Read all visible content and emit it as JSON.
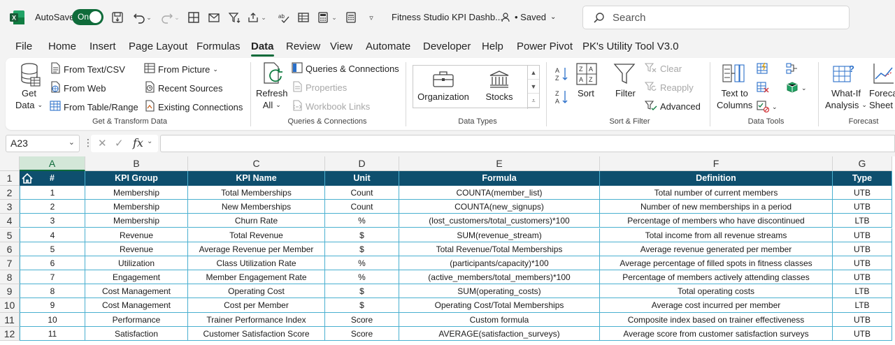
{
  "titlebar": {
    "autosave_label": "AutoSave",
    "toggle_state": "On",
    "doc_title": "Fitness Studio KPI Dashb...",
    "saved_status": "• Saved",
    "search_placeholder": "Search"
  },
  "menu": {
    "tabs": [
      "File",
      "Home",
      "Insert",
      "Page Layout",
      "Formulas",
      "Data",
      "Review",
      "View",
      "Automate",
      "Developer",
      "Help",
      "Power Pivot",
      "PK's Utility Tool V3.0"
    ],
    "active_tab": "Data"
  },
  "ribbon": {
    "get_data": [
      "Get",
      "Data"
    ],
    "from_text_csv": "From Text/CSV",
    "from_web": "From Web",
    "from_table_range": "From Table/Range",
    "from_picture": "From Picture",
    "recent_sources": "Recent Sources",
    "existing_connections": "Existing Connections",
    "group_get_transform": "Get & Transform Data",
    "refresh_all": [
      "Refresh",
      "All"
    ],
    "queries_connections": "Queries & Connections",
    "properties": "Properties",
    "workbook_links": "Workbook Links",
    "group_queries": "Queries & Connections",
    "organization": "Organization",
    "stocks": "Stocks",
    "group_data_types": "Data Types",
    "sort": "Sort",
    "filter": "Filter",
    "clear": "Clear",
    "reapply": "Reapply",
    "advanced": "Advanced",
    "group_sort_filter": "Sort & Filter",
    "text_to_columns": [
      "Text to",
      "Columns"
    ],
    "group_data_tools": "Data Tools",
    "what_if": [
      "What-If",
      "Analysis"
    ],
    "forecast_sheet": [
      "Foreca",
      "Sheet"
    ],
    "group_forecast": "Forecast"
  },
  "formula_bar": {
    "name_box": "A23",
    "fx": "fx",
    "formula": ""
  },
  "grid": {
    "columns": [
      "A",
      "B",
      "C",
      "D",
      "E",
      "F",
      "G"
    ],
    "selected_column": "A",
    "row_numbers": [
      "1",
      "2",
      "3",
      "4",
      "5",
      "6",
      "7",
      "8",
      "9",
      "10",
      "11",
      "12"
    ],
    "header": [
      "#",
      "KPI Group",
      "KPI Name",
      "Unit",
      "Formula",
      "Definition",
      "Type"
    ],
    "rows": [
      [
        "1",
        "Membership",
        "Total Memberships",
        "Count",
        "COUNTA(member_list)",
        "Total number of current members",
        "UTB"
      ],
      [
        "2",
        "Membership",
        "New Memberships",
        "Count",
        "COUNTA(new_signups)",
        "Number of new memberships in a period",
        "UTB"
      ],
      [
        "3",
        "Membership",
        "Churn Rate",
        "%",
        "(lost_customers/total_customers)*100",
        "Percentage of members who have discontinued",
        "LTB"
      ],
      [
        "4",
        "Revenue",
        "Total Revenue",
        "$",
        "SUM(revenue_stream)",
        "Total income from all revenue streams",
        "UTB"
      ],
      [
        "5",
        "Revenue",
        "Average Revenue per Member",
        "$",
        "Total Revenue/Total Memberships",
        "Average revenue generated per member",
        "UTB"
      ],
      [
        "6",
        "Utilization",
        "Class Utilization Rate",
        "%",
        "(participants/capacity)*100",
        "Average percentage of filled spots in fitness classes",
        "UTB"
      ],
      [
        "7",
        "Engagement",
        "Member Engagement Rate",
        "%",
        "(active_members/total_members)*100",
        "Percentage of members actively attending classes",
        "UTB"
      ],
      [
        "8",
        "Cost Management",
        "Operating Cost",
        "$",
        "SUM(operating_costs)",
        "Total operating costs",
        "LTB"
      ],
      [
        "9",
        "Cost Management",
        "Cost per Member",
        "$",
        "Operating Cost/Total Memberships",
        "Average cost incurred per member",
        "LTB"
      ],
      [
        "10",
        "Performance",
        "Trainer Performance Index",
        "Score",
        "Custom formula",
        "Composite index based on trainer effectiveness",
        "UTB"
      ],
      [
        "11",
        "Satisfaction",
        "Customer Satisfaction Score",
        "Score",
        "AVERAGE(satisfaction_surveys)",
        "Average score from customer satisfaction surveys",
        "UTB"
      ]
    ]
  },
  "colors": {
    "excel_green": "#0f6b3a",
    "header_fill": "#0e4f6e",
    "cell_border": "#4ab0d0"
  }
}
